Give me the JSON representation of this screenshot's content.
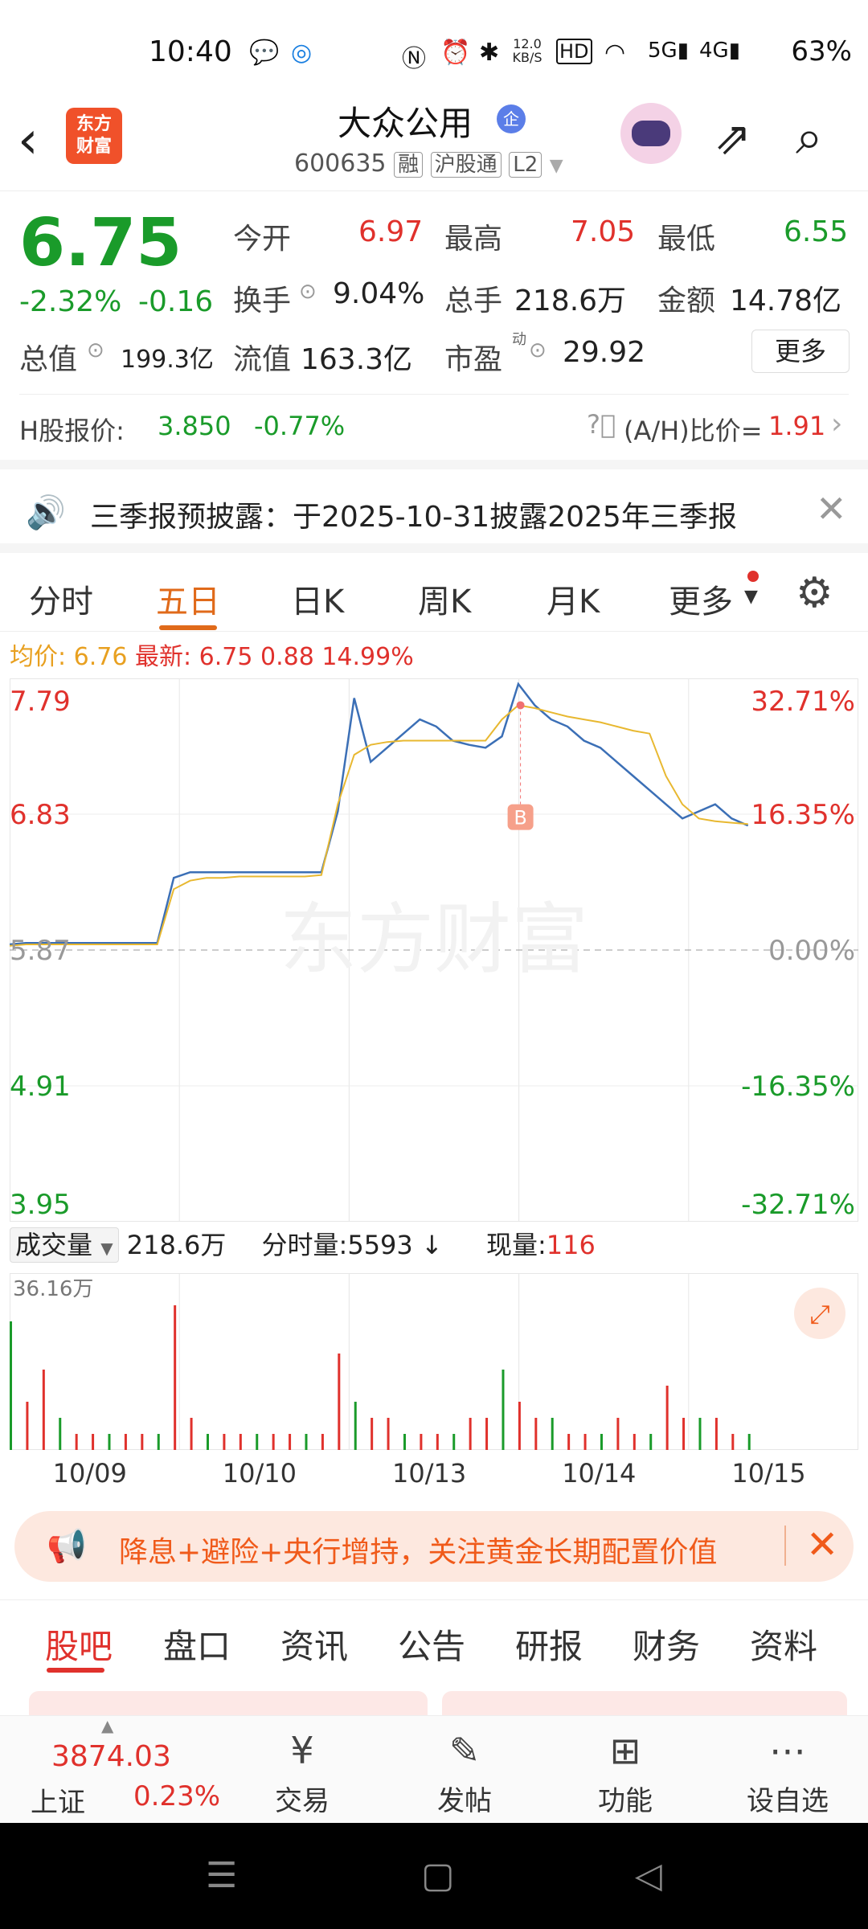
{
  "status_bar": {
    "time": "10:40",
    "speed": "12.0 KB/S",
    "battery": "63%",
    "icons": [
      "wechat-icon",
      "browser-icon",
      "nfc-icon",
      "alarm-icon",
      "bluetooth-icon",
      "hd-icon",
      "wifi-icon",
      "5g-signal-icon",
      "4g-signal-icon"
    ]
  },
  "nav": {
    "logo_line1": "东方",
    "logo_line2": "财富",
    "title": "大众公用",
    "title_badge": "企",
    "code": "600635",
    "tags": [
      "融",
      "沪股通",
      "L2"
    ]
  },
  "quote": {
    "price": "6.75",
    "change_pct": "-2.32%",
    "change": "-0.16",
    "rows": [
      [
        {
          "label": "今开",
          "value": "6.97",
          "color": "red"
        },
        {
          "label": "最高",
          "value": "7.05",
          "color": "red"
        },
        {
          "label": "最低",
          "value": "6.55",
          "color": "green"
        }
      ],
      [
        {
          "label": "换手",
          "value": "9.04%",
          "color": "dark"
        },
        {
          "label": "总手",
          "value": "218.6万",
          "color": "dark"
        },
        {
          "label": "金额",
          "value": "14.78亿",
          "color": "dark"
        }
      ],
      [
        {
          "label": "总值",
          "value": "199.3亿",
          "color": "dark"
        },
        {
          "label": "流值",
          "value": "163.3亿",
          "color": "dark"
        },
        {
          "label": "市盈",
          "value": "29.92",
          "color": "dark"
        }
      ]
    ],
    "pe_superscript": "动",
    "more_button": "更多"
  },
  "h_share": {
    "label": "H股报价:",
    "price": "3.850",
    "change": "-0.77%",
    "ratio_label": "(A/H)比价=",
    "ratio": "1.91"
  },
  "notice": {
    "text": "三季报预披露：于2025-10-31披露2025年三季报"
  },
  "chart_tabs": [
    "分时",
    "五日",
    "日K",
    "周K",
    "月K",
    "更多"
  ],
  "chart_info": {
    "avg_label": "均价:",
    "avg": "6.76",
    "latest_label": "最新:",
    "latest": "6.75",
    "latest_amt": "0.88",
    "latest_pct": "14.99%"
  },
  "chart_data": {
    "type": "line",
    "title": "",
    "watermark": "东方财富",
    "y_left_ticks": [
      "7.79",
      "6.83",
      "5.87",
      "4.91",
      "3.95"
    ],
    "y_right_ticks": [
      "32.71%",
      "16.35%",
      "0.00%",
      "-16.35%",
      "-32.71%"
    ],
    "ylim": [
      3.95,
      7.79
    ],
    "prev_close": 5.87,
    "x_categories": [
      "10/09",
      "10/10",
      "10/13",
      "10/14",
      "10/15"
    ],
    "marker_label": "B",
    "series": [
      {
        "name": "最新",
        "color": "#3b6fb6",
        "values": [
          5.91,
          5.92,
          5.92,
          5.92,
          5.92,
          5.92,
          5.92,
          5.92,
          5.92,
          5.92,
          6.38,
          6.42,
          6.42,
          6.42,
          6.42,
          6.42,
          6.42,
          6.42,
          6.42,
          6.42,
          6.85,
          7.65,
          7.2,
          7.3,
          7.4,
          7.5,
          7.45,
          7.35,
          7.32,
          7.3,
          7.38,
          7.75,
          7.6,
          7.5,
          7.45,
          7.35,
          7.3,
          7.2,
          7.1,
          7.0,
          6.9,
          6.8,
          6.85,
          6.9,
          6.8,
          6.75
        ]
      },
      {
        "name": "均价",
        "color": "#e8b830",
        "values": [
          5.9,
          5.91,
          5.91,
          5.91,
          5.91,
          5.91,
          5.91,
          5.91,
          5.91,
          5.91,
          6.3,
          6.36,
          6.38,
          6.38,
          6.39,
          6.39,
          6.39,
          6.39,
          6.39,
          6.4,
          6.9,
          7.25,
          7.32,
          7.34,
          7.35,
          7.35,
          7.35,
          7.35,
          7.35,
          7.35,
          7.5,
          7.6,
          7.58,
          7.55,
          7.52,
          7.5,
          7.48,
          7.45,
          7.42,
          7.4,
          7.1,
          6.9,
          6.8,
          6.78,
          6.77,
          6.76
        ]
      }
    ]
  },
  "volume_bar": {
    "dropdown": "成交量",
    "total": "218.6万",
    "tick_label": "分时量:5593",
    "arrow": "↓",
    "now_label": "现量:",
    "now": "116",
    "max_label": "36.16万",
    "volumes": [
      8,
      3,
      5,
      2,
      1,
      1,
      1,
      1,
      1,
      1,
      9,
      2,
      1,
      1,
      1,
      1,
      1,
      1,
      1,
      1,
      6,
      3,
      2,
      2,
      1,
      1,
      1,
      1,
      2,
      2,
      5,
      3,
      2,
      2,
      1,
      1,
      1,
      2,
      1,
      1,
      4,
      2,
      2,
      2,
      1,
      1
    ]
  },
  "banner": {
    "text": "降息+避险+央行增持，关注黄金长期配置价值"
  },
  "sub_tabs": [
    "股吧",
    "盘口",
    "资讯",
    "公告",
    "研报",
    "财务",
    "资料"
  ],
  "bottom_bar": {
    "index_value": "3874.03",
    "index_name": "上证",
    "index_change": "0.23%",
    "items": [
      {
        "label": "交易",
        "icon": "yen-trade-icon"
      },
      {
        "label": "发帖",
        "icon": "edit-post-icon"
      },
      {
        "label": "功能",
        "icon": "grid-apps-icon"
      },
      {
        "label": "设自选",
        "icon": "more-dots-icon"
      }
    ]
  }
}
